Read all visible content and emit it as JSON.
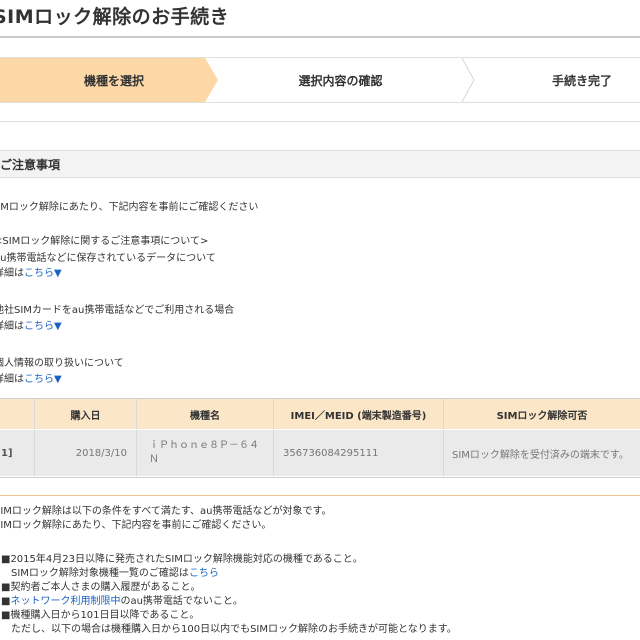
{
  "page": {
    "title": "SIMロック解除のお手続き"
  },
  "steps": [
    {
      "label": "機種を選択",
      "active": true
    },
    {
      "label": "選択内容の確認",
      "active": false
    },
    {
      "label": "手続き完了",
      "active": false
    }
  ],
  "notice": {
    "header": "ご注意事項",
    "intro": "SIMロック解除にあたり、下記内容を事前にご確認ください",
    "block_heading": "<SIMロック解除に関するご注意事項について>",
    "items": [
      {
        "title": "au携帯電話などに保存されているデータについて",
        "detail_prefix": "詳細は",
        "link": "こちら",
        "arrow": "▼"
      },
      {
        "title": "他社SIMカードをau携帯電話などでご利用される場合",
        "detail_prefix": "詳細は",
        "link": "こちら",
        "arrow": "▼"
      },
      {
        "title": "個人情報の取り扱いについて",
        "detail_prefix": "詳細は",
        "link": "こちら",
        "arrow": "▼"
      }
    ]
  },
  "table": {
    "headers": [
      "購入日",
      "機種名",
      "IMEI／MEID (端末製造番号)",
      "SIMロック解除可否"
    ],
    "rows": [
      {
        "index": "1]",
        "date": "2018/3/10",
        "model_line1": "ｉＰｈｏｎｅ８Ｐ－６４",
        "model_line2": "Ｎ",
        "imei": "356736084295111",
        "status": "SIMロック解除を受付済みの端末です。"
      }
    ]
  },
  "conditions": {
    "intro_lines": [
      "SIMロック解除は以下の条件をすべて満たす、au携帯電話などが対象です。",
      "SIMロック解除にあたり、下記内容を事前にご確認ください。"
    ],
    "items": [
      {
        "text": "■2015年4月23日以降に発売されたSIMロック解除機能対応の機種であること。"
      },
      {
        "text_prefix": "　SIMロック解除対象機種一覧のご確認は",
        "link": "こちら"
      },
      {
        "text": "■契約者ご本人さまの購入履歴があること。"
      },
      {
        "marker": "■",
        "link": "ネットワーク利用制限中",
        "text_suffix": "のau携帯電話でないこと。"
      },
      {
        "text": "■機種購入日から101日目以降であること。"
      },
      {
        "text": "　ただし、以下の場合は機種購入日から100日以内でもSIMロック解除のお手続きが可能となります。"
      }
    ]
  },
  "colors": {
    "active_step": "#fbd8a6",
    "table_header": "#fbe6c8",
    "link": "#1a62c6"
  }
}
